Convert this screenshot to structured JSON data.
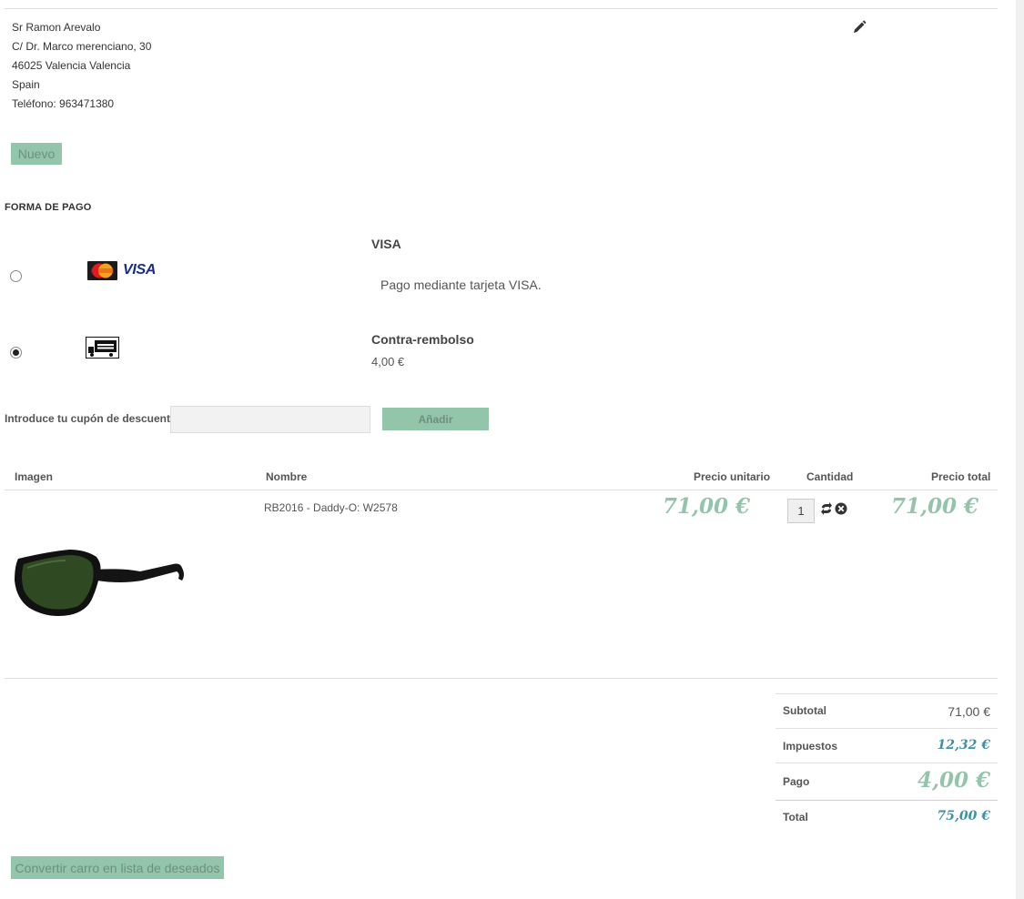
{
  "address": {
    "line1": "Sr Ramon Arevalo",
    "line2": "C/ Dr. Marco merenciano, 30",
    "line3": "46025 Valencia Valencia",
    "line4": "Spain",
    "line5": "Teléfono: 963471380",
    "edit_icon": "pencil-icon"
  },
  "buttons": {
    "nuevo": "Nuevo",
    "anadir": "Añadir",
    "convertir": "Convertir carro en lista de deseados"
  },
  "payment": {
    "section_title": "FORMA DE PAGO",
    "methods": [
      {
        "title": "VISA",
        "description": "Pago mediante tarjeta VISA.",
        "selected": false,
        "logos": [
          "mastercard-logo",
          "visa-logo"
        ]
      },
      {
        "title": "Contra-rembolso",
        "fee": "4,00 €",
        "selected": true,
        "logos": [
          "delivery-truck-icon"
        ]
      }
    ],
    "visa_logo_text": "VISA"
  },
  "coupon": {
    "label": "Introduce tu cupón de descuento",
    "value": "",
    "placeholder": ""
  },
  "cart": {
    "headers": {
      "imagen": "Imagen",
      "nombre": "Nombre",
      "precio_unitario": "Precio unitario",
      "cantidad": "Cantidad",
      "precio_total": "Precio total"
    },
    "items": [
      {
        "image": "sunglasses-product-image",
        "name": "RB2016 - Daddy-O: W2578",
        "unit_price": "71,00 €",
        "quantity": "1",
        "total_price": "71,00 €"
      }
    ]
  },
  "totals": {
    "subtotal_label": "Subtotal",
    "subtotal_value": "71,00 €",
    "impuestos_label": "Impuestos",
    "impuestos_value": "12,32 €",
    "pago_label": "Pago",
    "pago_value": "4,00 €",
    "total_label": "Total",
    "total_value": "75,00 €"
  },
  "colors": {
    "accent_green": "#93c5aa",
    "price_blue": "#3f8fa6"
  }
}
